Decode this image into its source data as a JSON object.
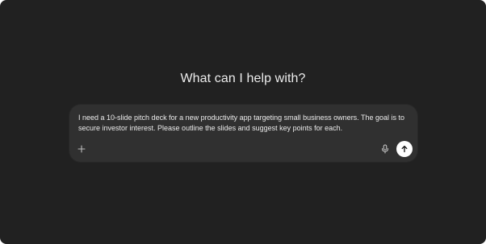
{
  "main": {
    "heading": "What can I help with?"
  },
  "composer": {
    "prompt_text": "I need a 10-slide pitch deck for a new productivity app targeting small business owners. The goal is to secure investor interest. Please outline the slides and suggest key points for each.",
    "buttons": {
      "add": "plus-icon",
      "voice": "microphone-icon",
      "send": "arrow-up-icon"
    }
  },
  "colors": {
    "background": "#212121",
    "composer": "#303030",
    "text": "#ececec",
    "send_button": "#ffffff"
  }
}
